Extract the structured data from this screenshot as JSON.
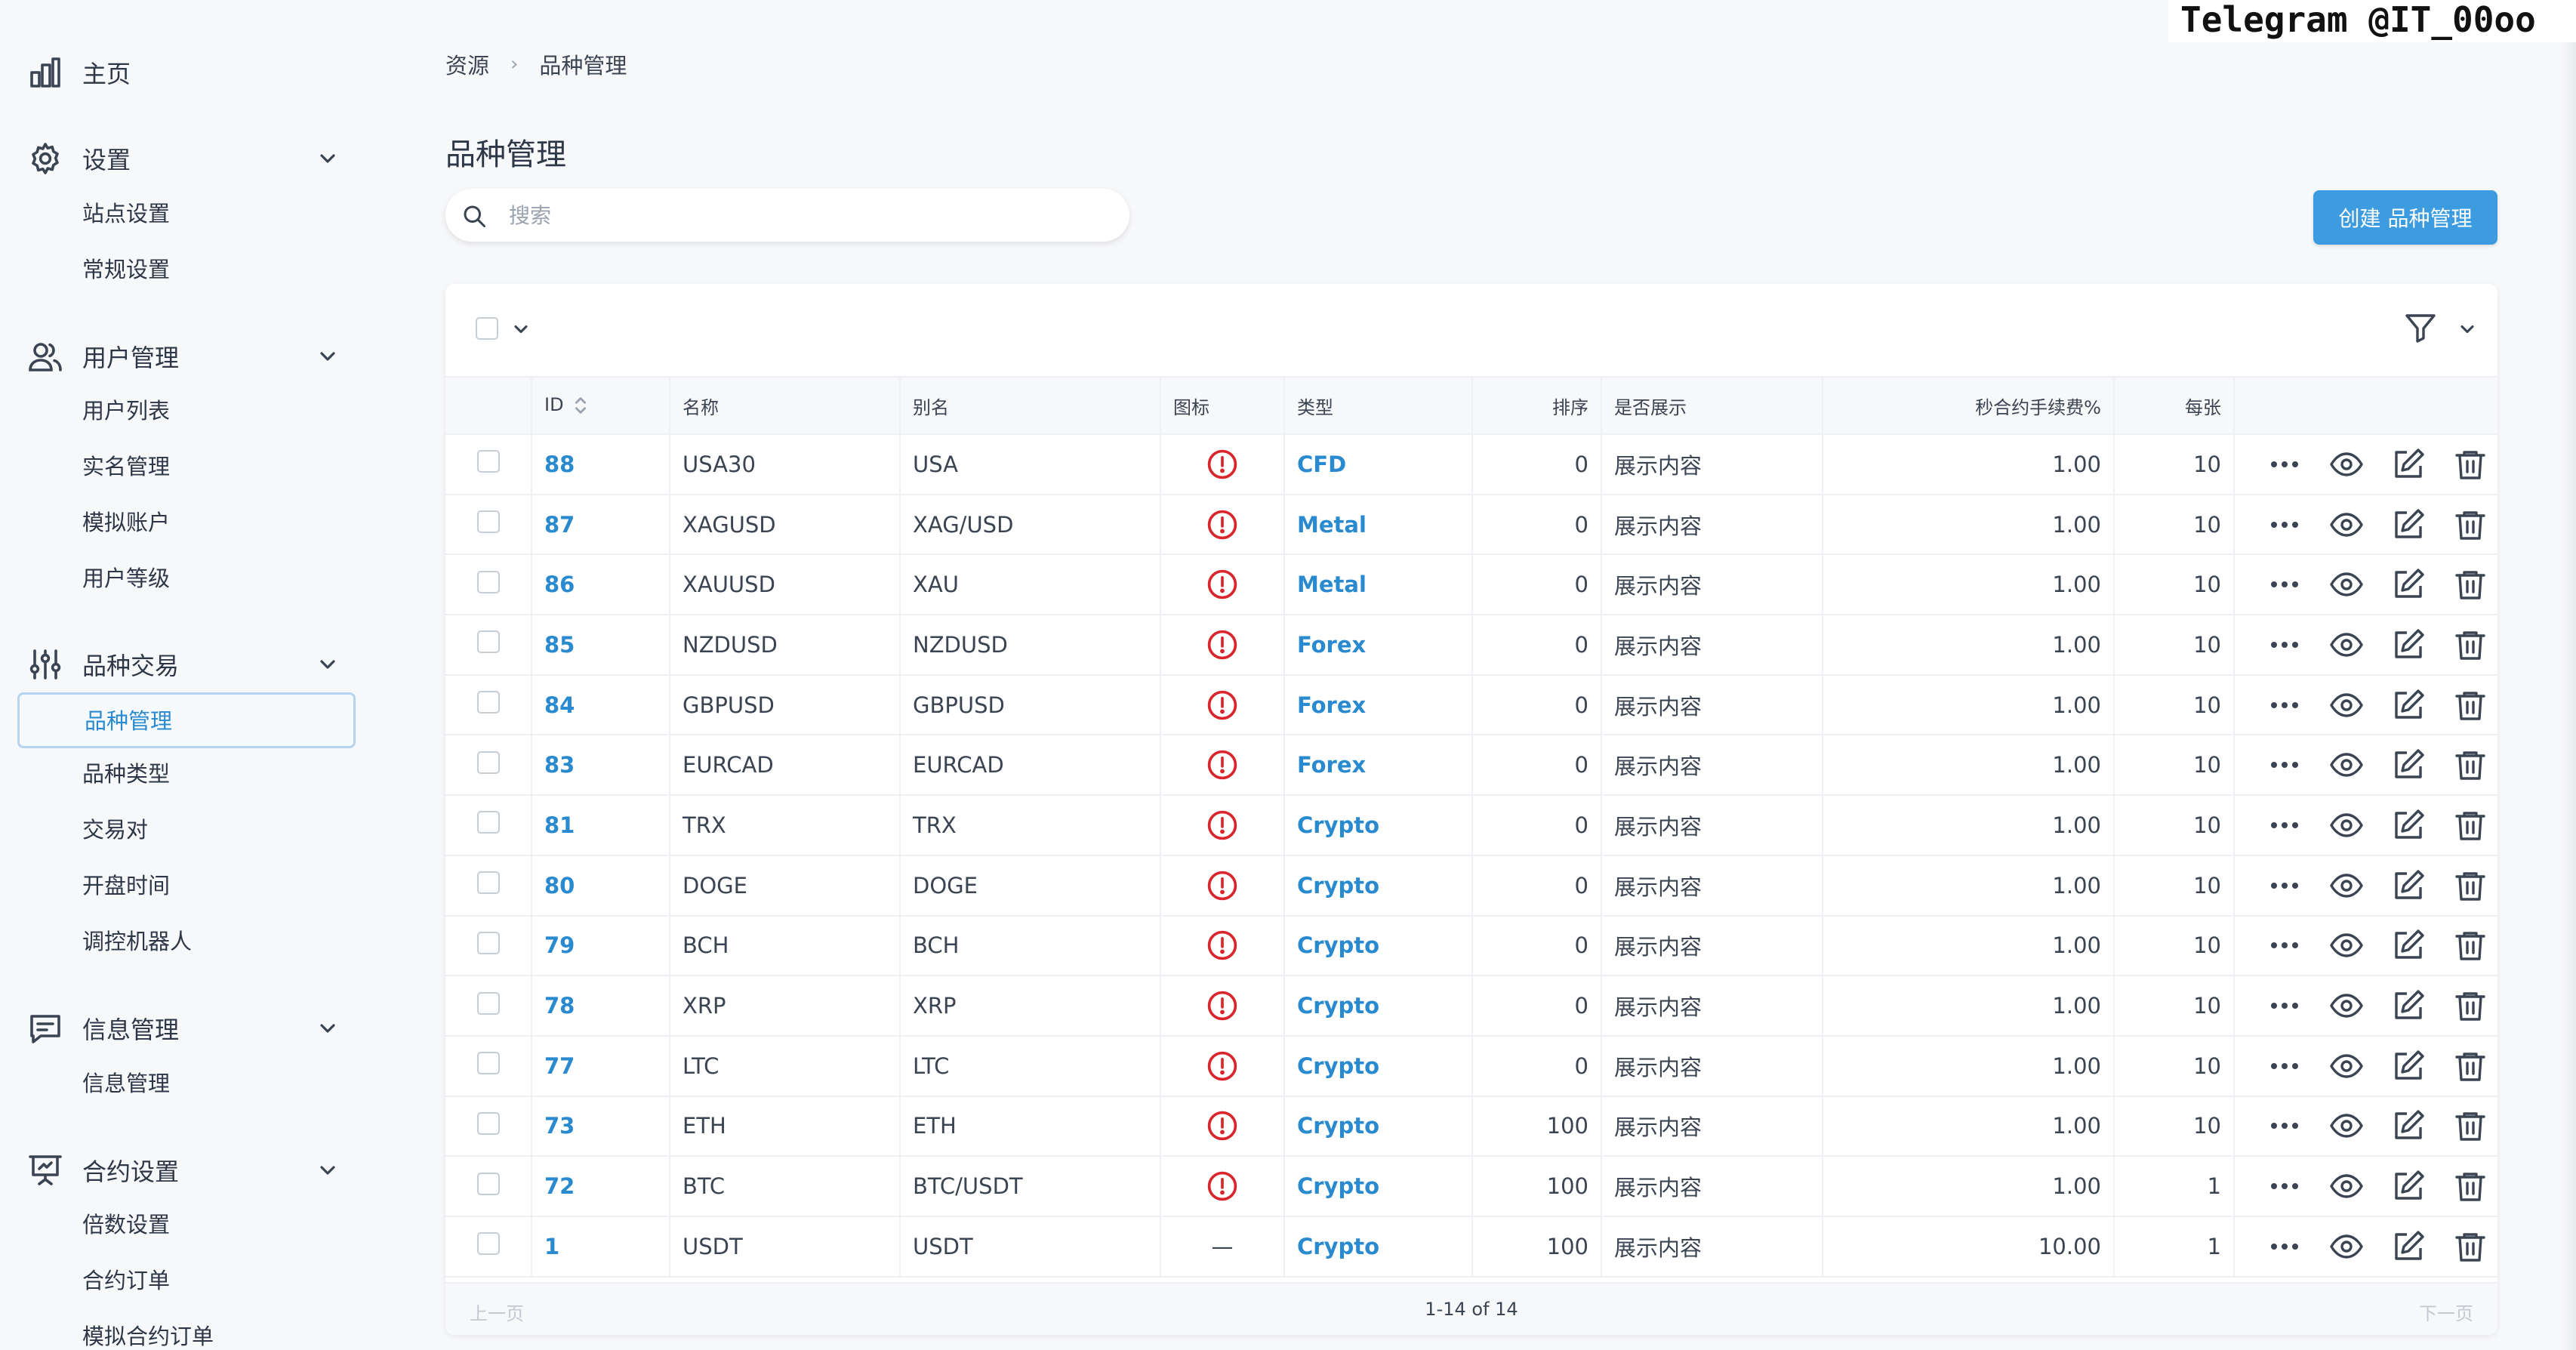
{
  "watermark": "Telegram @IT_00oo",
  "sidebar": {
    "home": {
      "label": "主页",
      "icon": "bar-chart-icon"
    },
    "settings": {
      "label": "设置",
      "icon": "gear-icon",
      "items": [
        "站点设置",
        "常规设置"
      ]
    },
    "users": {
      "label": "用户管理",
      "icon": "users-icon",
      "items": [
        "用户列表",
        "实名管理",
        "模拟账户",
        "用户等级"
      ]
    },
    "trading": {
      "label": "品种交易",
      "icon": "sliders-icon",
      "items": [
        "品种管理",
        "品种类型",
        "交易对",
        "开盘时间",
        "调控机器人"
      ],
      "active_index": 0
    },
    "messages": {
      "label": "信息管理",
      "icon": "message-icon",
      "items": [
        "信息管理"
      ]
    },
    "contracts": {
      "label": "合约设置",
      "icon": "presentation-icon",
      "items": [
        "倍数设置",
        "合约订单",
        "模拟合约订单"
      ]
    }
  },
  "breadcrumb": {
    "root": "资源",
    "current": "品种管理"
  },
  "page_title": "品种管理",
  "search": {
    "placeholder": "搜索",
    "value": ""
  },
  "create_button": "创建 品种管理",
  "table": {
    "columns": {
      "id": "ID",
      "name": "名称",
      "alias": "别名",
      "icon": "图标",
      "type": "类型",
      "sort": "排序",
      "show": "是否展示",
      "fee": "秒合约手续费%",
      "per": "每张"
    },
    "rows": [
      {
        "id": "88",
        "name": "USA30",
        "alias": "USA",
        "icon": "warning",
        "type": "CFD",
        "sort": "0",
        "show": "展示内容",
        "fee": "1.00",
        "per": "10"
      },
      {
        "id": "87",
        "name": "XAGUSD",
        "alias": "XAG/USD",
        "icon": "warning",
        "type": "Metal",
        "sort": "0",
        "show": "展示内容",
        "fee": "1.00",
        "per": "10"
      },
      {
        "id": "86",
        "name": "XAUUSD",
        "alias": "XAU",
        "icon": "warning",
        "type": "Metal",
        "sort": "0",
        "show": "展示内容",
        "fee": "1.00",
        "per": "10"
      },
      {
        "id": "85",
        "name": "NZDUSD",
        "alias": "NZDUSD",
        "icon": "warning",
        "type": "Forex",
        "sort": "0",
        "show": "展示内容",
        "fee": "1.00",
        "per": "10"
      },
      {
        "id": "84",
        "name": "GBPUSD",
        "alias": "GBPUSD",
        "icon": "warning",
        "type": "Forex",
        "sort": "0",
        "show": "展示内容",
        "fee": "1.00",
        "per": "10"
      },
      {
        "id": "83",
        "name": "EURCAD",
        "alias": "EURCAD",
        "icon": "warning",
        "type": "Forex",
        "sort": "0",
        "show": "展示内容",
        "fee": "1.00",
        "per": "10"
      },
      {
        "id": "81",
        "name": "TRX",
        "alias": "TRX",
        "icon": "warning",
        "type": "Crypto",
        "sort": "0",
        "show": "展示内容",
        "fee": "1.00",
        "per": "10"
      },
      {
        "id": "80",
        "name": "DOGE",
        "alias": "DOGE",
        "icon": "warning",
        "type": "Crypto",
        "sort": "0",
        "show": "展示内容",
        "fee": "1.00",
        "per": "10"
      },
      {
        "id": "79",
        "name": "BCH",
        "alias": "BCH",
        "icon": "warning",
        "type": "Crypto",
        "sort": "0",
        "show": "展示内容",
        "fee": "1.00",
        "per": "10"
      },
      {
        "id": "78",
        "name": "XRP",
        "alias": "XRP",
        "icon": "warning",
        "type": "Crypto",
        "sort": "0",
        "show": "展示内容",
        "fee": "1.00",
        "per": "10"
      },
      {
        "id": "77",
        "name": "LTC",
        "alias": "LTC",
        "icon": "warning",
        "type": "Crypto",
        "sort": "0",
        "show": "展示内容",
        "fee": "1.00",
        "per": "10"
      },
      {
        "id": "73",
        "name": "ETH",
        "alias": "ETH",
        "icon": "warning",
        "type": "Crypto",
        "sort": "100",
        "show": "展示内容",
        "fee": "1.00",
        "per": "10"
      },
      {
        "id": "72",
        "name": "BTC",
        "alias": "BTC/USDT",
        "icon": "warning",
        "type": "Crypto",
        "sort": "100",
        "show": "展示内容",
        "fee": "1.00",
        "per": "1"
      },
      {
        "id": "1",
        "name": "USDT",
        "alias": "USDT",
        "icon": "—",
        "type": "Crypto",
        "sort": "100",
        "show": "展示内容",
        "fee": "10.00",
        "per": "1"
      }
    ]
  },
  "pagination": {
    "prev": "上一页",
    "info": "1-14 of 14",
    "next": "下一页"
  },
  "colors": {
    "accent": "#2a8ad0",
    "button": "#3d9ce0",
    "warning": "#d9262c"
  }
}
